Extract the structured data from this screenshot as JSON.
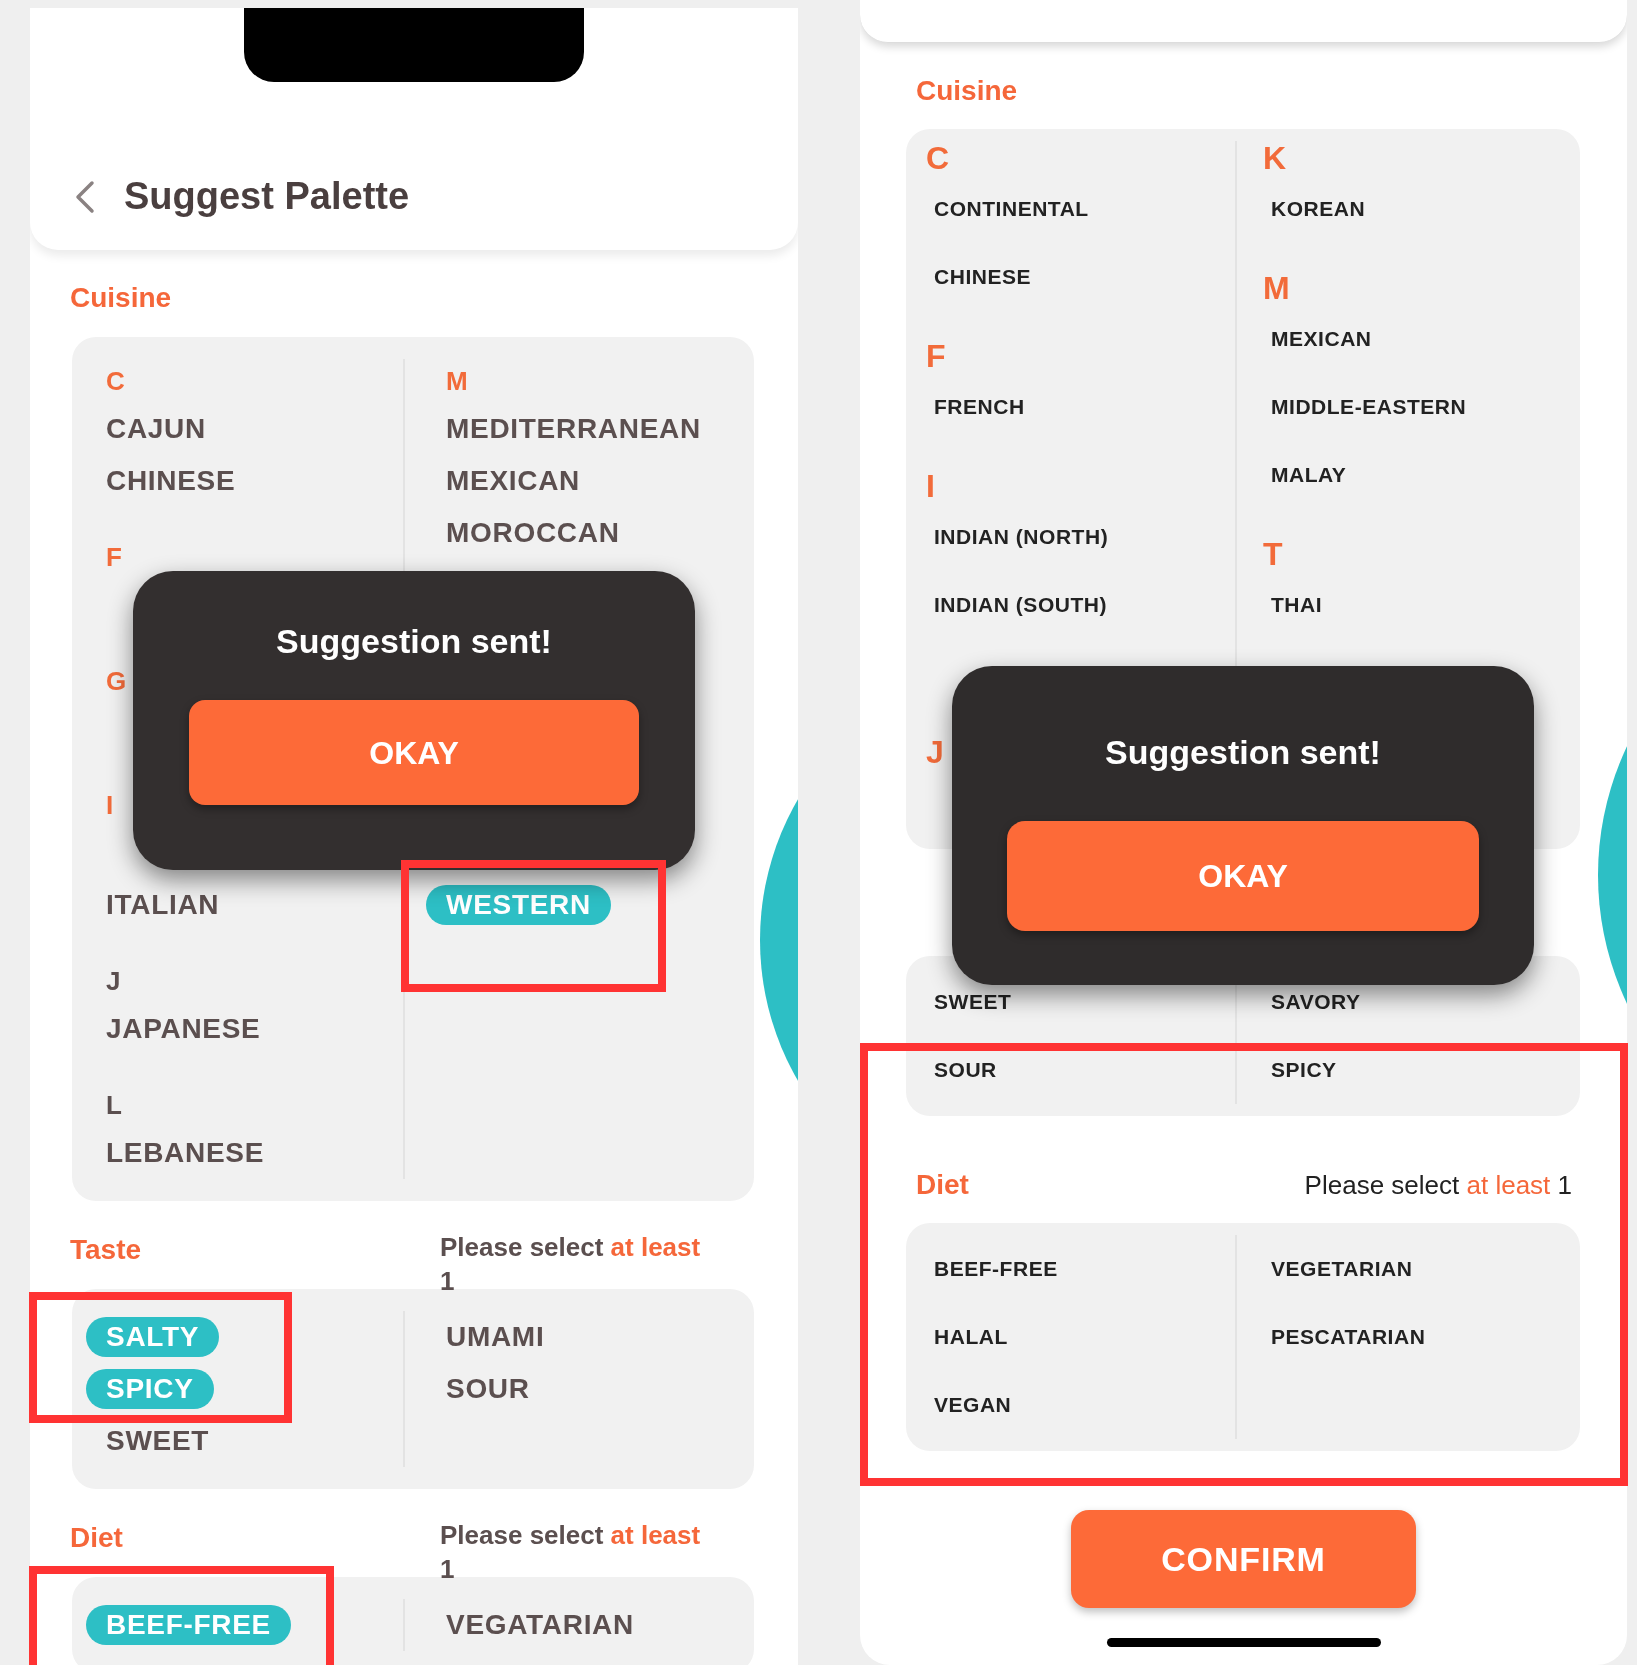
{
  "phones": [
    {
      "header": {
        "title": "Suggest Palette"
      },
      "sections": [
        {
          "title": "Cuisine",
          "columns": [
            [
              {
                "kind": "letter",
                "text": "C",
                "color": "#f26b3a"
              },
              {
                "kind": "item",
                "text": "CAJUN",
                "selected": false
              },
              {
                "kind": "item",
                "text": "CHINESE",
                "selected": false
              },
              {
                "kind": "gap"
              },
              {
                "kind": "letter",
                "text": "F",
                "color": "#f26b3a"
              },
              {
                "kind": "covered_item"
              },
              {
                "kind": "gap"
              },
              {
                "kind": "letter",
                "text": "G",
                "color": "#f26b3a"
              },
              {
                "kind": "covered_item"
              },
              {
                "kind": "gap"
              },
              {
                "kind": "letter",
                "text": "I",
                "color": "#f26b3a"
              },
              {
                "kind": "covered_item"
              },
              {
                "kind": "item",
                "text": "ITALIAN",
                "selected": false
              },
              {
                "kind": "gap"
              },
              {
                "kind": "letter",
                "text": "J",
                "color": "#5b4f4f"
              },
              {
                "kind": "item",
                "text": "JAPANESE",
                "selected": false
              },
              {
                "kind": "gap"
              },
              {
                "kind": "letter",
                "text": "L",
                "color": "#5b4f4f"
              },
              {
                "kind": "item",
                "text": "LEBANESE",
                "selected": false
              }
            ],
            [
              {
                "kind": "letter",
                "text": "M",
                "color": "#f26b3a"
              },
              {
                "kind": "item",
                "text": "MEDITERRANEAN",
                "selected": false
              },
              {
                "kind": "item",
                "text": "MEXICAN",
                "selected": false
              },
              {
                "kind": "item",
                "text": "MOROCCAN",
                "selected": false
              },
              {
                "kind": "gap"
              },
              {
                "kind": "covered_letter"
              },
              {
                "kind": "covered_item"
              },
              {
                "kind": "gap"
              },
              {
                "kind": "covered_letter"
              },
              {
                "kind": "covered_item"
              },
              {
                "kind": "gap"
              },
              {
                "kind": "covered_letter"
              },
              {
                "kind": "item",
                "text": "WESTERN",
                "selected": true
              }
            ]
          ]
        },
        {
          "title": "Taste",
          "hint": {
            "text": "Please select",
            "accent": "at least",
            "tail": "1"
          },
          "columns": [
            [
              {
                "kind": "item",
                "text": "SALTY",
                "selected": true
              },
              {
                "kind": "item",
                "text": "SPICY",
                "selected": true
              },
              {
                "kind": "item",
                "text": "SWEET",
                "selected": false
              }
            ],
            [
              {
                "kind": "item",
                "text": "UMAMI",
                "selected": false
              },
              {
                "kind": "item",
                "text": "SOUR",
                "selected": false
              }
            ]
          ]
        },
        {
          "title": "Diet",
          "hint": {
            "text": "Please select",
            "accent": "at least",
            "tail": "1"
          },
          "columns": [
            [
              {
                "kind": "item",
                "text": "BEEF-FREE",
                "selected": true
              }
            ],
            [
              {
                "kind": "item",
                "text": "VEGATARIAN",
                "selected": false
              }
            ]
          ]
        }
      ],
      "dialog": {
        "title": "Suggestion sent!",
        "button": "OKAY"
      }
    },
    {
      "sections": [
        {
          "title": "Cuisine",
          "columns": [
            [
              {
                "kind": "letter",
                "text": "C",
                "color": "#f26b3a"
              },
              {
                "kind": "item",
                "text": "CONTINENTAL",
                "selected": false
              },
              {
                "kind": "item",
                "text": "CHINESE",
                "selected": false
              },
              {
                "kind": "gap"
              },
              {
                "kind": "letter",
                "text": "F",
                "color": "#f26b3a"
              },
              {
                "kind": "item",
                "text": "FRENCH",
                "selected": false
              },
              {
                "kind": "gap"
              },
              {
                "kind": "letter",
                "text": "I",
                "color": "#f26b3a"
              },
              {
                "kind": "item",
                "text": "INDIAN (NORTH)",
                "selected": false
              },
              {
                "kind": "item",
                "text": "INDIAN (SOUTH)",
                "selected": false
              },
              {
                "kind": "covered_item"
              },
              {
                "kind": "gap"
              },
              {
                "kind": "letter",
                "text": "J",
                "color": "#f26b3a"
              },
              {
                "kind": "covered_item"
              }
            ],
            [
              {
                "kind": "letter",
                "text": "K",
                "color": "#f26b3a"
              },
              {
                "kind": "item",
                "text": "KOREAN",
                "selected": false
              },
              {
                "kind": "gap"
              },
              {
                "kind": "letter",
                "text": "M",
                "color": "#f26b3a"
              },
              {
                "kind": "item",
                "text": "MEXICAN",
                "selected": false
              },
              {
                "kind": "item",
                "text": "MIDDLE-EASTERN",
                "selected": false
              },
              {
                "kind": "item",
                "text": "MALAY",
                "selected": false
              },
              {
                "kind": "gap"
              },
              {
                "kind": "letter",
                "text": "T",
                "color": "#f26b3a"
              },
              {
                "kind": "item",
                "text": "THAI",
                "selected": false
              },
              {
                "kind": "gap"
              },
              {
                "kind": "covered_letter"
              },
              {
                "kind": "covered_item"
              }
            ]
          ]
        },
        {
          "columns": [
            [
              {
                "kind": "item",
                "text": "SWEET",
                "selected": false
              },
              {
                "kind": "item",
                "text": "SOUR",
                "selected": false
              }
            ],
            [
              {
                "kind": "item",
                "text": "SAVORY",
                "selected": false
              },
              {
                "kind": "item",
                "text": "SPICY",
                "selected": false
              }
            ]
          ]
        },
        {
          "title": "Diet",
          "hint": {
            "text": "Please select",
            "accent": "at least",
            "tail": "1"
          },
          "columns": [
            [
              {
                "kind": "item",
                "text": "BEEF-FREE",
                "selected": false
              },
              {
                "kind": "item",
                "text": "HALAL",
                "selected": false
              },
              {
                "kind": "item",
                "text": "VEGAN",
                "selected": false
              }
            ],
            [
              {
                "kind": "item",
                "text": "VEGETARIAN",
                "selected": false
              },
              {
                "kind": "item",
                "text": "PESCATARIAN",
                "selected": false
              }
            ]
          ]
        }
      ],
      "dialog": {
        "title": "Suggestion sent!",
        "button": "OKAY"
      },
      "confirm_button": "CONFIRM"
    }
  ]
}
